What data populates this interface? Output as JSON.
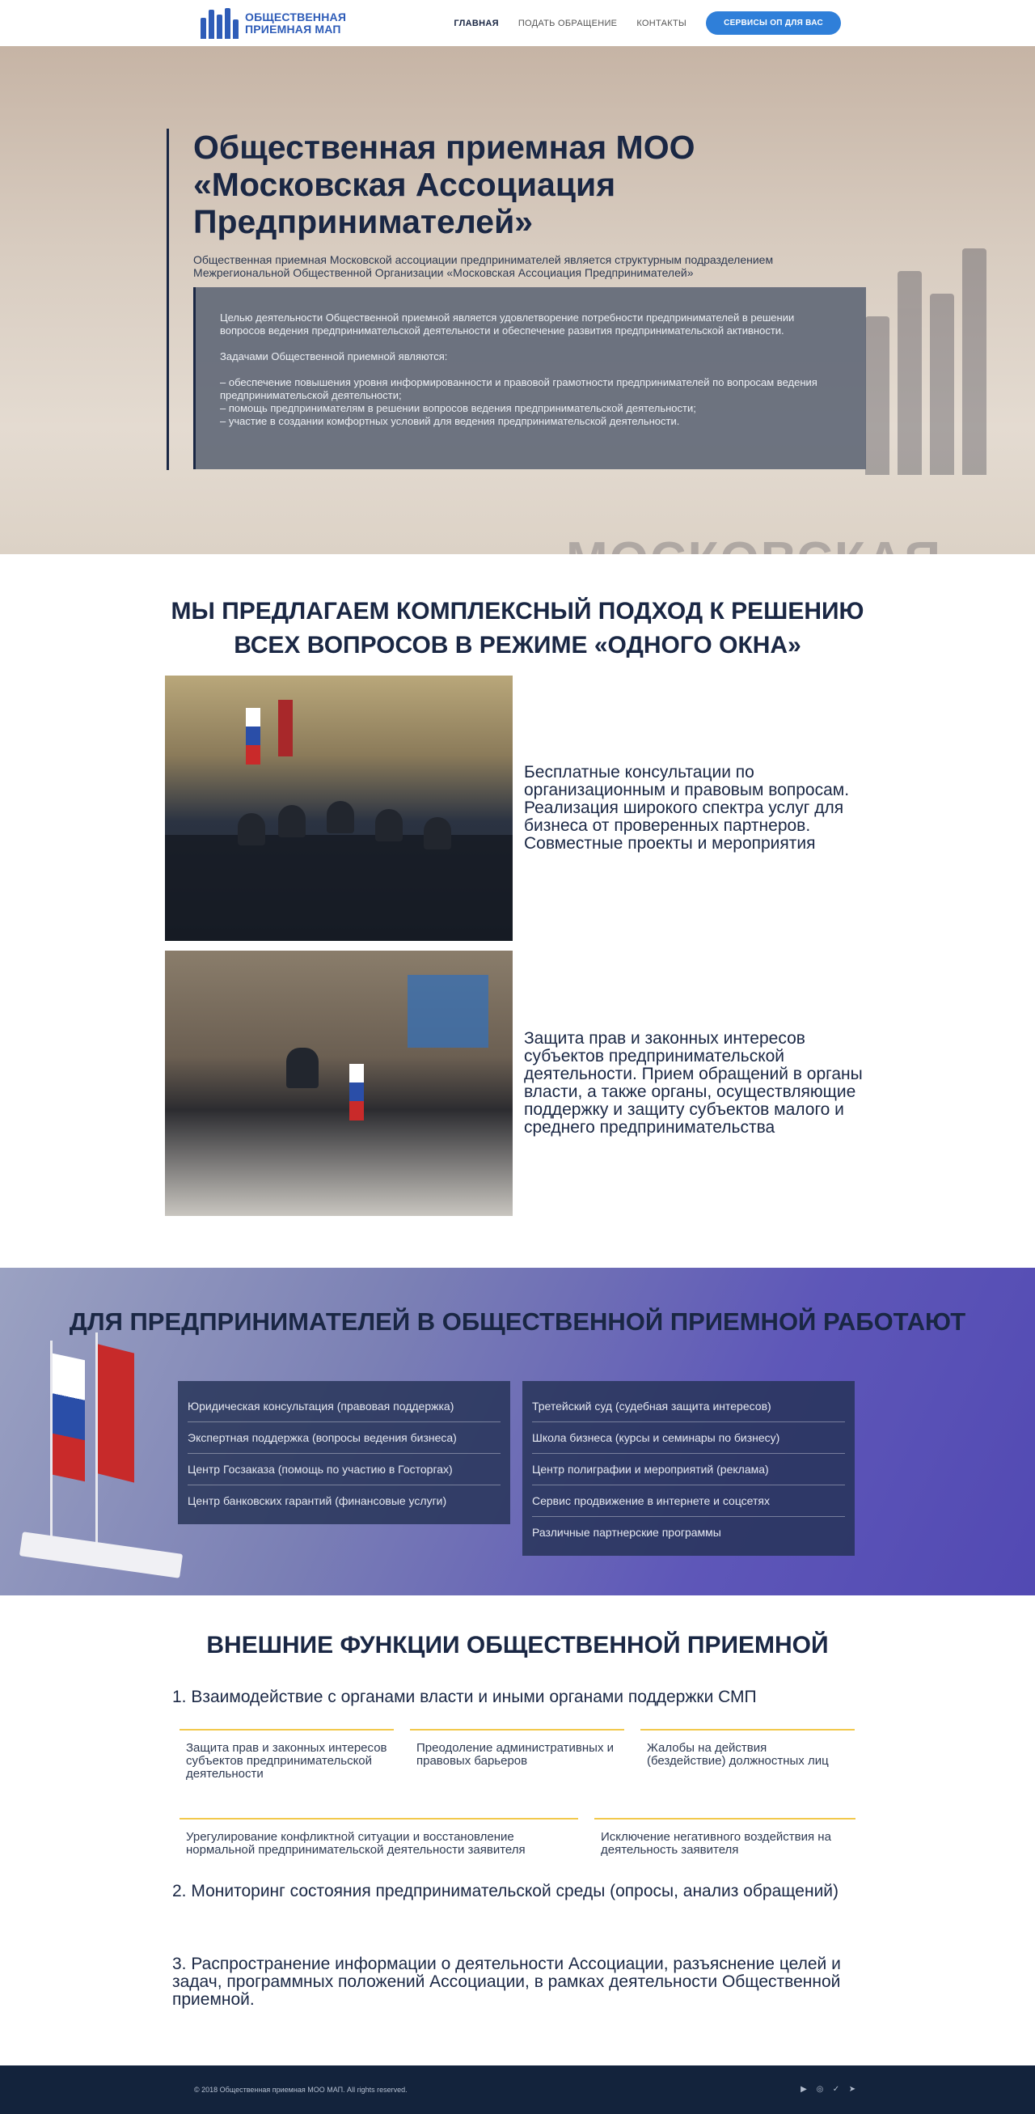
{
  "header": {
    "logo_line1": "Общественная",
    "logo_line2": "приемная МАП",
    "nav": [
      {
        "label": "Главная"
      },
      {
        "label": "Подать обращение"
      },
      {
        "label": "Контакты"
      }
    ],
    "cta_label": "Сервисы ОП для вас"
  },
  "hero": {
    "title": "Общественная приемная МОО «Московская Ассоциация Предпринимателей»",
    "subtitle": "Общественная приемная Московской ассоциации предпринимателей является структурным подразделением Межрегиональной Общественной Организации «Московская Ассоциация Предпринимателей»",
    "box_p1": "Целью деятельности Общественной приемной является удовлетворение потребности предпринимателей в решении вопросов ведения предпринимательской деятельности и обеспечение развития предпринимательской активности.",
    "box_p2": "Задачами Общественной приемной являются:",
    "box_list": [
      "– обеспечение повышения уровня информированности и правовой грамотности предпринимателей по вопросам ведения предпринимательской деятельности;",
      "– помощь предпринимателям в решении вопросов ведения предпринимательской деятельности;",
      "– участие в создании комфортных условий для ведения предпринимательской деятельности."
    ],
    "watermark": "Московская"
  },
  "offer": {
    "heading": "Мы предлагаем комплексный подход к решению всех вопросов в режиме «одного окна»",
    "rows": [
      {
        "text": "Бесплатные консультации по организационным и правовым вопросам. Реализация широкого спектра услуг для бизнеса от проверенных партнеров. Совместные проекты и мероприятия"
      },
      {
        "text": "Защита прав и законных интересов субъектов предпринимательской деятельности. Прием обращений в органы власти, а также органы, осуществляющие поддержку и защиту субъектов малого и среднего предпринимательства"
      }
    ]
  },
  "work": {
    "heading": "Для предпринимателей в Общественной приемной работают",
    "left": [
      "Юридическая консультация (правовая поддержка)",
      "Экспертная поддержка (вопросы ведения бизнеса)",
      "Центр Госзаказа (помощь по участию в Госторгах)",
      "Центр банковских гарантий (финансовые услуги)"
    ],
    "right": [
      "Третейский суд (судебная защита интересов)",
      "Школа бизнеса (курсы и семинары по бизнесу)",
      "Центр полиграфии и мероприятий (реклама)",
      "Сервис продвижение в интернете и соцсетях",
      "Различные партнерские программы"
    ]
  },
  "ext": {
    "heading": "Внешние функции Общественной приемной",
    "item1": "1. Взаимодействие с органами власти и иными органами поддержки СМП",
    "cards_row1": [
      "Защита прав и законных интересов субъектов предпринимательской деятельности",
      "Преодоление административных и правовых барьеров",
      "Жалобы на действия (бездействие) должностных лиц"
    ],
    "cards_row2": [
      "Урегулирование конфликтной ситуации и восстановление нормальной предпринимательской деятельности заявителя",
      "Исключение негативного воздействия на деятельность заявителя"
    ],
    "item2": "2. Мониторинг состояния предпринимательской среды (опросы, анализ обращений)",
    "item3": "3. Распространение информации о деятельности Ассоциации, разъяснение целей и задач, программных положений Ассоциации, в рамках деятельности Общественной приемной."
  },
  "footer": {
    "copyright": "© 2018 Общественная приемная МОО МАП. All rights reserved.",
    "socials": [
      "youtube-icon",
      "instagram-icon",
      "vk-icon",
      "telegram-icon"
    ]
  },
  "colors": {
    "primary": "#1a2744",
    "accent": "#2f7fd9",
    "card_border": "#f2c94c",
    "footer_bg": "#13233c"
  }
}
